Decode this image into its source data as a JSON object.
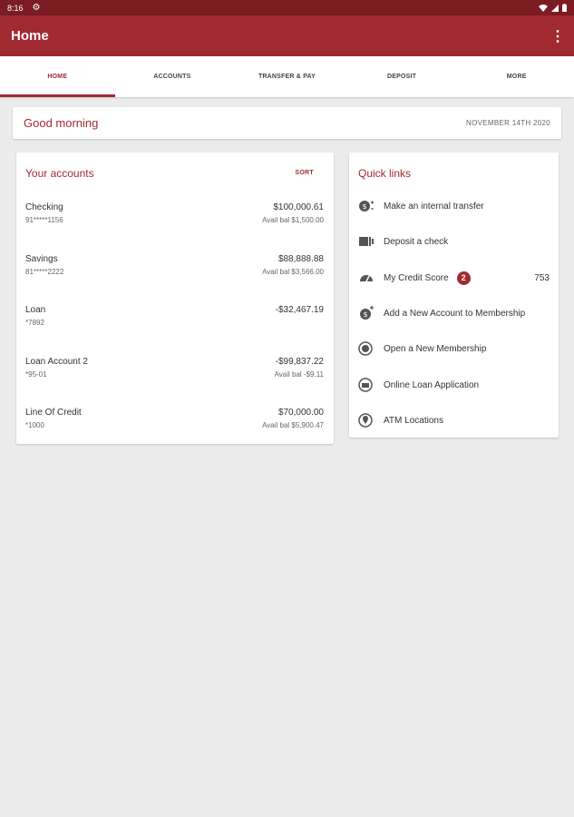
{
  "status_bar": {
    "time": "8:16"
  },
  "app_bar": {
    "title": "Home"
  },
  "tabs": [
    {
      "label": "HOME"
    },
    {
      "label": "ACCOUNTS"
    },
    {
      "label": "TRANSFER & PAY"
    },
    {
      "label": "DEPOSIT"
    },
    {
      "label": "MORE"
    }
  ],
  "greeting": {
    "text": "Good morning",
    "date": "NOVEMBER 14TH 2020"
  },
  "accounts": {
    "title": "Your accounts",
    "sort_label": "SORT",
    "items": [
      {
        "name": "Checking",
        "number": "91*****1156",
        "balance": "$100,000.61",
        "avail": "Avail bal $1,500.00"
      },
      {
        "name": "Savings",
        "number": "81*****2222",
        "balance": "$88,888.88",
        "avail": "Avail bal $3,566.00"
      },
      {
        "name": "Loan",
        "number": "*7892",
        "balance": "-$32,467.19",
        "avail": ""
      },
      {
        "name": "Loan Account 2",
        "number": "*95-01",
        "balance": "-$99,837.22",
        "avail": "Avail bal -$9.11"
      },
      {
        "name": "Line Of Credit",
        "number": "*1000",
        "balance": "$70,000.00",
        "avail": "Avail bal $5,900.47"
      }
    ]
  },
  "quick_links": {
    "title": "Quick links",
    "items": [
      {
        "label": "Make an internal transfer",
        "icon": "transfer-icon"
      },
      {
        "label": "Deposit a check",
        "icon": "check-deposit-icon"
      },
      {
        "label": "My Credit Score",
        "icon": "gauge-icon",
        "badge": "2",
        "value": "753"
      },
      {
        "label": "Add a New Account to Membership",
        "icon": "add-account-icon"
      },
      {
        "label": "Open a New Membership",
        "icon": "membership-icon"
      },
      {
        "label": "Online Loan Application",
        "icon": "loan-application-icon"
      },
      {
        "label": "ATM Locations",
        "icon": "location-pin-icon"
      }
    ]
  },
  "colors": {
    "brand": "#a12a31",
    "status_bar": "#7a1c22",
    "background": "#ececec"
  }
}
